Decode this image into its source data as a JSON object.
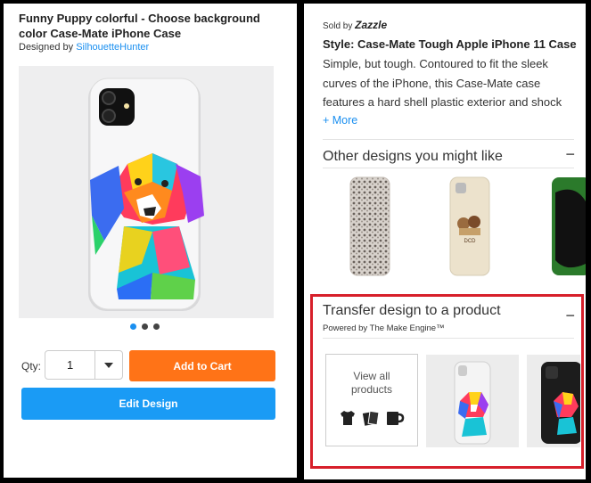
{
  "product": {
    "title": "Funny Puppy colorful - Choose background color Case-Mate iPhone Case",
    "designed_by_label": "Designed by",
    "designer": "SilhouetteHunter",
    "carousel_dots": 3,
    "carousel_active": 1
  },
  "purchase": {
    "qty_label": "Qty:",
    "qty_value": "1",
    "add_to_cart": "Add to Cart",
    "edit_design": "Edit Design"
  },
  "details": {
    "sold_by_label": "Sold by",
    "seller": "Zazzle",
    "style": "Style: Case-Mate Tough Apple iPhone 11 Case",
    "description": "Simple, but tough. Contoured to fit the sleek curves of the iPhone, this Case-Mate case features a hard shell plastic exterior and shock",
    "more": "+ More"
  },
  "other_designs": {
    "heading": "Other designs you might like",
    "toggle": "−",
    "thumb_text": "DCD"
  },
  "transfer": {
    "heading": "Transfer design to a product",
    "toggle": "−",
    "powered_by": "Powered by The Make Engine™",
    "view_all_line1": "View all",
    "view_all_line2": "products"
  },
  "colors": {
    "orange": "#ff7317",
    "blue": "#1a9bf5",
    "link": "#1a8ff0",
    "highlight": "#d71f2a"
  }
}
